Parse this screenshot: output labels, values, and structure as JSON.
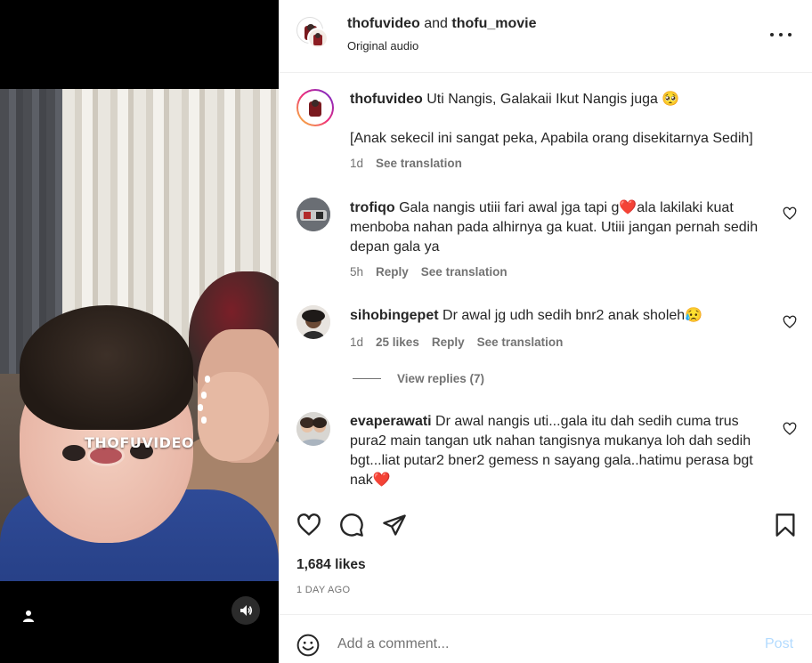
{
  "post": {
    "author_primary": "thofuvideo",
    "joiner": " and ",
    "author_secondary": "thofu_movie",
    "audio": "Original audio",
    "watermark": "THOFUVIDEO"
  },
  "caption": {
    "username": "thofuvideo",
    "text": " Uti Nangis, Galakaii Ikut Nangis juga 🥺",
    "text2": "[Anak sekecil ini sangat peka, Apabila orang disekitarnya Sedih]",
    "time": "1d",
    "translate": "See translation"
  },
  "comments": [
    {
      "username": "trofiqo",
      "text": " Gala nangis utiii fari awal jga tapi g❤️ala lakilaki kuat menboba nahan pada alhirnya ga kuat. Utiii jangan pernah sedih depan gala ya",
      "time": "5h",
      "reply": "Reply",
      "translate": "See translation"
    },
    {
      "username": "sihobingepet",
      "text": " Dr awal jg udh sedih bnr2 anak sholeh😥",
      "time": "1d",
      "likes": "25 likes",
      "reply": "Reply",
      "translate": "See translation",
      "view_replies": "View replies (7)"
    },
    {
      "username": "evaperawati",
      "text": " Dr awal nangis uti...gala itu dah sedih cuma trus pura2 main tangan utk nahan tangisnya mukanya loh dah sedih bgt...liat putar2 bner2 gemess n sayang gala..hatimu perasa bgt nak❤️"
    }
  ],
  "stats": {
    "likes": "1,684 likes",
    "date": "1 DAY AGO"
  },
  "composer": {
    "placeholder": "Add a comment...",
    "post_label": "Post"
  },
  "colors": {
    "text": "#262626",
    "muted": "#737373",
    "post_disabled": "#b3dbff",
    "heart_red": "#ed4956"
  },
  "icons": [
    "heart-icon",
    "comment-icon",
    "share-icon",
    "bookmark-icon",
    "emoji-icon",
    "more-icon",
    "sound-icon",
    "tag-user-icon"
  ]
}
